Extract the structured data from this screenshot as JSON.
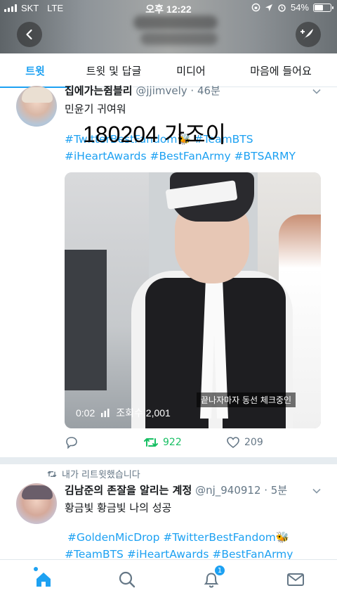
{
  "status_bar": {
    "carrier": "SKT",
    "network": "LTE",
    "time": "오후 12:22",
    "battery_percent": "54%",
    "battery_level": 0.54
  },
  "header": {
    "back_icon": "chevron-left-icon",
    "compose_icon": "compose-quill-icon"
  },
  "tabs": [
    {
      "label": "트윗",
      "active": true
    },
    {
      "label": "트윗 및 답글",
      "active": false
    },
    {
      "label": "미디어",
      "active": false
    },
    {
      "label": "마음에 들어요",
      "active": false
    }
  ],
  "tweet1": {
    "display_name": "집에가는쥠블리",
    "handle": "@jjimvely · 46분",
    "text": "민윤기 귀여워",
    "overlay_text": "180204 가조이",
    "hashtags_line1": "#TwitterBestFandom🐝 #TeamBTS",
    "hashtags_line2": "#iHeartAwards #BestFanArmy #BTSARMY",
    "video": {
      "duration": "0:02",
      "views": "조회수 2,001",
      "caption": "끝나자마자 동선 체크중인"
    },
    "actions": {
      "retweets": "922",
      "likes": "209"
    }
  },
  "tweet2": {
    "retweeted_by": "내가 리트윗했습니다",
    "display_name": "김남준의 존잘을 알리는 계정",
    "handle": "@nj_940912 · 5분",
    "text": "황금빛 황금빛 나의 성공",
    "hashtags_line1": "#GoldenMicDrop #TwitterBestFandom🐝",
    "hashtags_line2": "#TeamBTS #iHeartAwards #BestFanArmy"
  },
  "bottom_nav": {
    "notification_badge": "1",
    "colors": {
      "accent": "#1da1f2",
      "retweet": "#17bf63"
    }
  }
}
